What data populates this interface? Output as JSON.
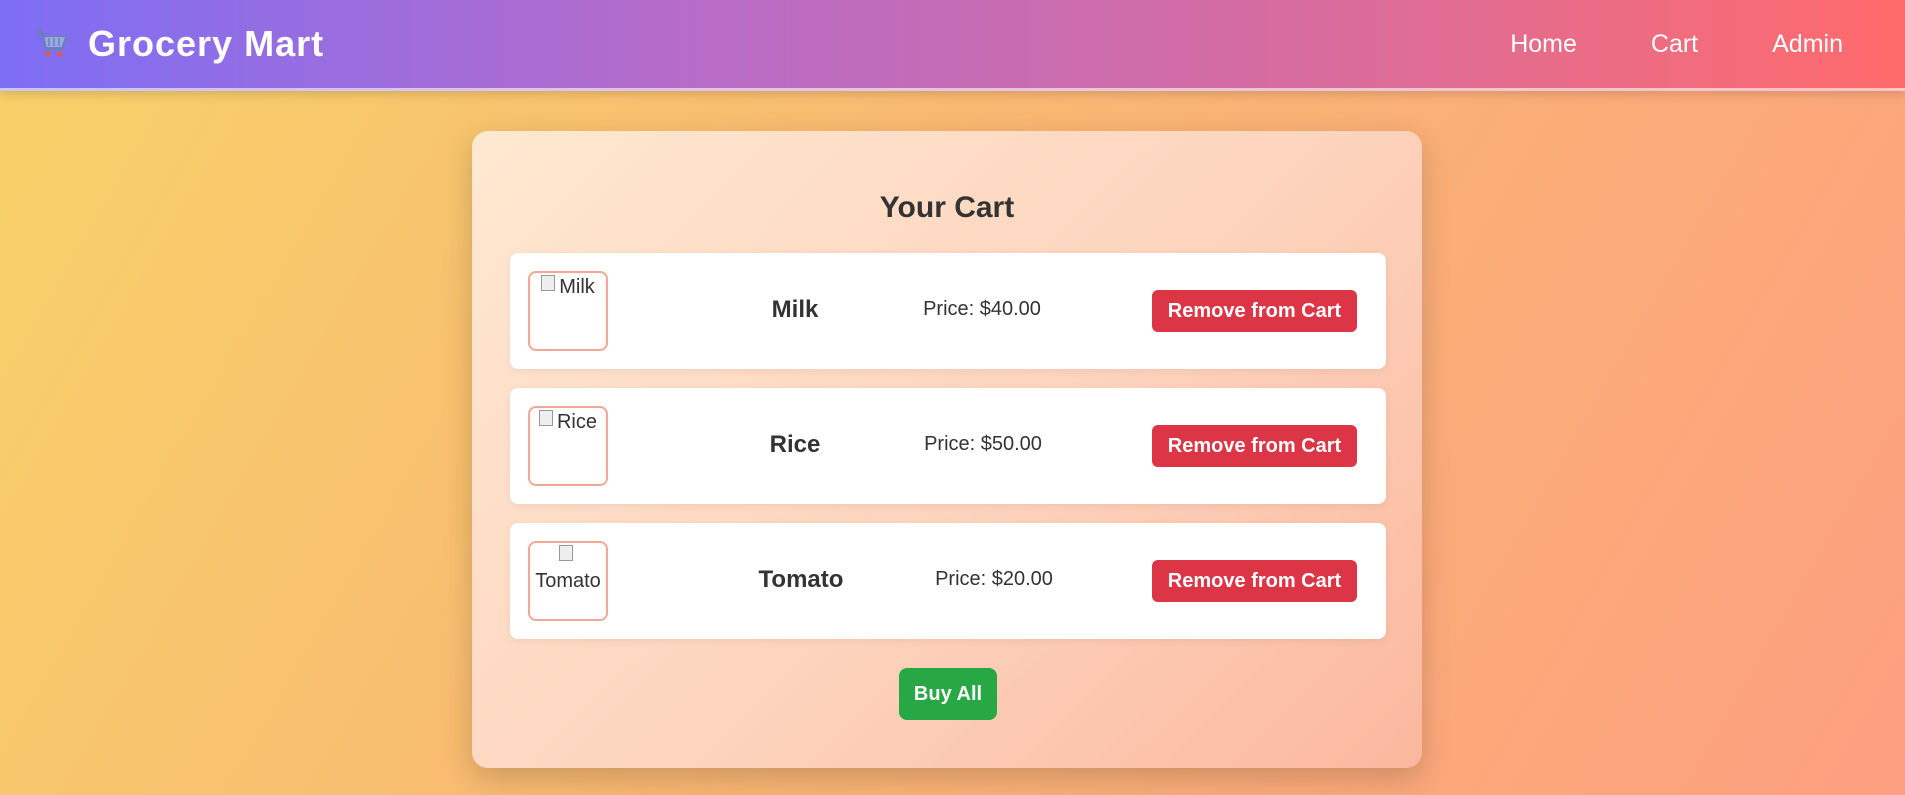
{
  "header": {
    "brand_icon": "shopping-cart-icon",
    "title": "Grocery Mart",
    "nav": [
      {
        "label": "Home"
      },
      {
        "label": "Cart"
      },
      {
        "label": "Admin"
      }
    ]
  },
  "cart": {
    "title": "Your Cart",
    "items": [
      {
        "image_alt": "Milk",
        "name": "Milk",
        "price": "Price: $40.00",
        "remove_label": "Remove from Cart"
      },
      {
        "image_alt": "Rice",
        "name": "Rice",
        "price": "Price: $50.00",
        "remove_label": "Remove from Cart"
      },
      {
        "image_alt": "Tomato",
        "name": "Tomato",
        "price": "Price: $20.00",
        "remove_label": "Remove from Cart"
      }
    ],
    "buy_all_label": "Buy All"
  },
  "colors": {
    "remove_button": "#dc3545",
    "buy_button": "#28a745",
    "image_border": "#f3a795"
  }
}
